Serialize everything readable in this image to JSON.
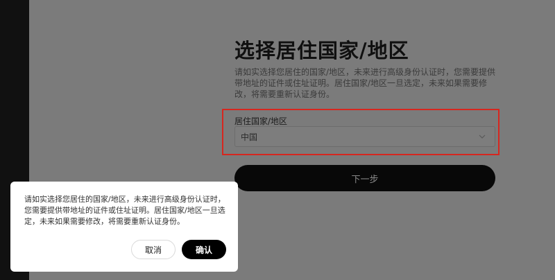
{
  "page": {
    "title": "选择居住国家/地区",
    "description": "请如实选择您居住的国家/地区，未来进行高级身份认证时，您需要提供带地址的证件或住址证明。居住国家/地区一旦选定，未来如果需要修改，将需要重新认证身份。",
    "field_label": "居住国家/地区",
    "select_value": "中国",
    "next_label": "下一步"
  },
  "dialog": {
    "text": "请如实选择您居住的国家/地区，未来进行高级身份认证时，您需要提供带地址的证件或住址证明。居住国家/地区一旦选定，未来如果需要修改，将需要重新认证身份。",
    "cancel_label": "取消",
    "confirm_label": "确认"
  },
  "colors": {
    "highlight_border": "#d7261e",
    "primary_button": "#080808",
    "overlay": "#7b7b7b"
  }
}
